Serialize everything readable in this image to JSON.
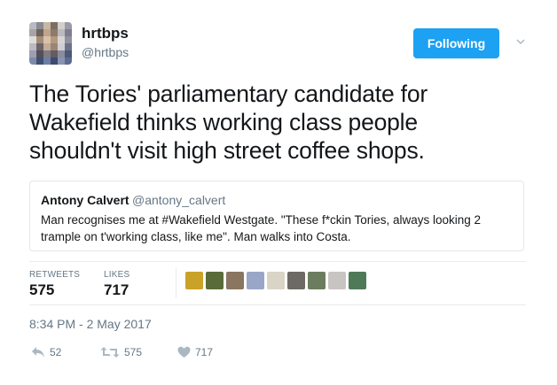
{
  "author": {
    "name": "hrtbps",
    "handle": "@hrtbps",
    "avatar_colors": [
      "#b9b9c1",
      "#8a8a92",
      "#c9b7a3",
      "#7c6e63",
      "#d3d0cc",
      "#9a9aa8",
      "#a6a4a8",
      "#6f6258",
      "#c0a58c",
      "#8d7a6a",
      "#bcbac0",
      "#7d7f8e",
      "#e0dcd8",
      "#a28d7c",
      "#d8c2ac",
      "#b6987e",
      "#d7d5d3",
      "#8f90a0",
      "#bcb9c2",
      "#6d6368",
      "#c4ac97",
      "#9c8574",
      "#cfcdd2",
      "#6c7288",
      "#9d9eb0",
      "#52505a",
      "#7e7a86",
      "#625d64",
      "#8b8c9e",
      "#4b5a7a",
      "#7d8aa8",
      "#3f4f74",
      "#6f7da3",
      "#3e4a6e",
      "#8a93b0",
      "#5c6a90"
    ]
  },
  "follow_button": {
    "label": "Following",
    "color": "#1da1f2"
  },
  "caret_icon": "chevron-down-icon",
  "tweet": {
    "lines": [
      "The Tories' parliamentary candidate for",
      "Wakefield thinks working class people",
      "shouldn't visit high street coffee shops."
    ]
  },
  "quoted_tweet": {
    "name": "Antony Calvert",
    "handle": "@antony_calvert",
    "lines": [
      "Man recognises me at #Wakefield Westgate. \"These f*ckin Tories, always looking 2",
      "trample on t'working class, like me\". Man walks into Costa."
    ]
  },
  "stats": {
    "retweets_label": "RETWEETS",
    "retweets": "575",
    "likes_label": "LIKES",
    "likes": "717"
  },
  "likers": [
    "#c9a227",
    "#5a6b3a",
    "#8a7560",
    "#9aa6c8",
    "#d9d4c6",
    "#6d6a66",
    "#6b7d5e",
    "#c8c4c2",
    "#4e7a58"
  ],
  "timestamp": "8:34 PM - 2 May 2017",
  "actions": {
    "reply_count": "52",
    "retweet_count": "575",
    "like_count": "717"
  },
  "colors": {
    "accent": "#1da1f2",
    "muted": "#657786",
    "icon": "#aab8c2"
  }
}
